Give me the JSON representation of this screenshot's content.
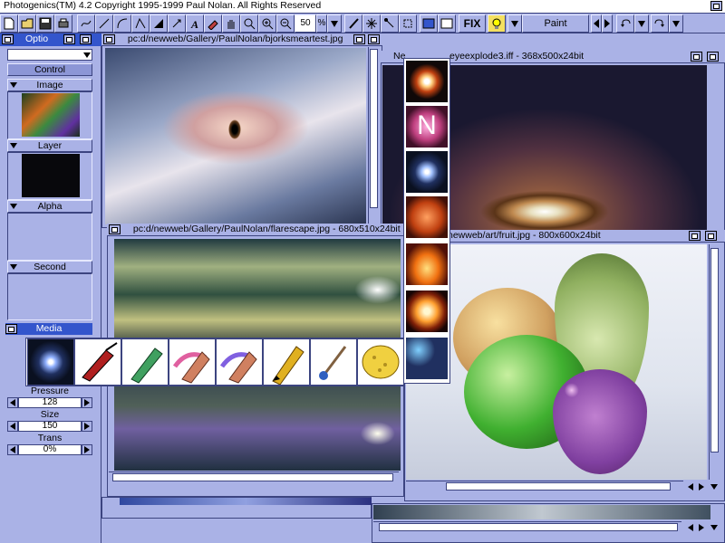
{
  "app": {
    "title": "Photogenics(TM) 4.2 Copyright 1995-1999 Paul Nolan.  All Rights Reserved"
  },
  "toolbar": {
    "zoom_value": "50",
    "zoom_unit": "%",
    "fix_label": "FIX",
    "mode_label": "Paint"
  },
  "sidebar": {
    "title": "Optio",
    "control_label": "Control",
    "image_label": "Image",
    "layer_label": "Layer",
    "alpha_label": "Alpha",
    "second_label": "Second",
    "media_label": "Media",
    "pressure_label": "Pressure",
    "pressure_value": "128",
    "size_label": "Size",
    "size_value": "150",
    "trans_label": "Trans",
    "trans_value": "0%"
  },
  "windows": {
    "bjorks": {
      "title": "pc:d/newweb/Gallery/PaulNolan/bjorksmeartest.jpg"
    },
    "eyeexplode": {
      "title_left": "Ne",
      "title_right": "eyeexplode3.iff - 368x500x24bit"
    },
    "flarescape": {
      "title": "pc:d/newweb/Gallery/PaulNolan/flarescape.jpg - 680x510x24bit"
    },
    "fruit": {
      "title": "newweb/art/fruit.jpg - 800x600x24bit"
    }
  },
  "colors": {
    "workbench": "#aab2e6",
    "shadow": "#3c4480",
    "highlight": "#e6e9ff",
    "media_header": "#3355cc"
  }
}
